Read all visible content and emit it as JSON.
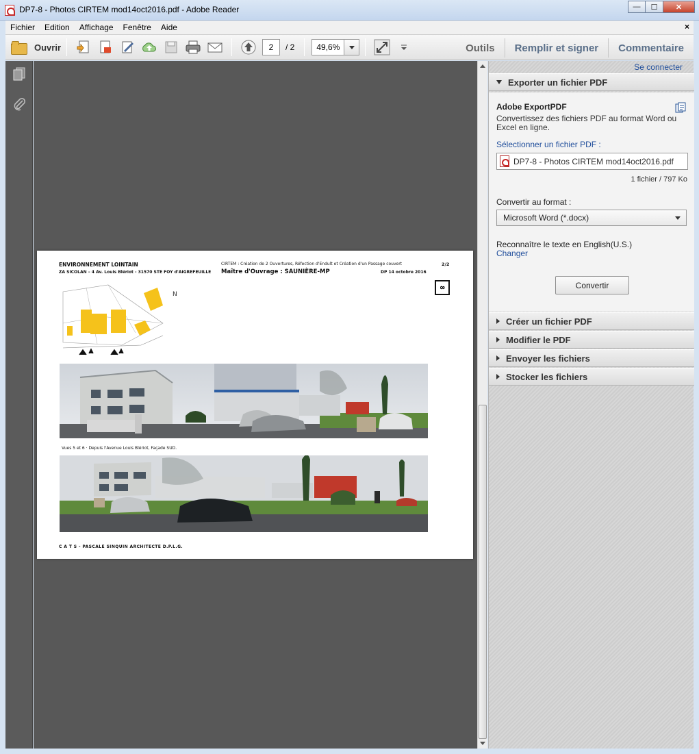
{
  "window": {
    "title": "DP7-8 - Photos CIRTEM mod14oct2016.pdf - Adobe Reader",
    "minimize": "—",
    "maximize": "☐",
    "close": "✕"
  },
  "menu": {
    "items": [
      "Fichier",
      "Edition",
      "Affichage",
      "Fenêtre",
      "Aide"
    ],
    "close_doc": "×"
  },
  "toolbar": {
    "open_label": "Ouvrir",
    "page_current": "2",
    "page_total": "/ 2",
    "zoom": "49,6%",
    "tools_label": "Outils",
    "fill_sign_label": "Remplir et signer",
    "comment_label": "Commentaire"
  },
  "pdf_page": {
    "header_left_1": "ENVIRONNEMENT  LOINTAIN",
    "header_left_2": "ZA  SICOLAN – 4 Av. Louis Blériot  - 31570 STE FOY d'AIGREFEUILLE",
    "header_mid_1": "CIRTEM :  Création de 2 Ouvertures,  Réfection d'Endult et Création d'un Passage couvert",
    "header_mid_2": "Maître d'Ouvrage : SAUNIÈRE-MP",
    "header_right_1": "2/2",
    "header_right_2": "DP 14 octobre 2016",
    "page_box": "8",
    "caption": "Vues 5 et 6  ·  Depuis l'Avenue Louis Blériot, Façade SUD.",
    "footer": "C  A  T  S   -   PASCALE SINQUIN   ARCHITECTE D.P.L.G."
  },
  "right_panel": {
    "connect": "Se connecter",
    "export_header": "Exporter un fichier PDF",
    "export_title": "Adobe ExportPDF",
    "export_desc": "Convertissez des fichiers PDF au format Word ou Excel en ligne.",
    "select_label": "Sélectionner un fichier PDF :",
    "file_name": "DP7-8 - Photos CIRTEM mod14oct2016.pdf",
    "file_count": "1 fichier / 797 Ko",
    "format_label": "Convertir au format :",
    "format_value": "Microsoft Word (*.docx)",
    "ocr_text": "Reconnaître le texte en English(U.S.)",
    "change_label": "Changer",
    "convert_button": "Convertir",
    "sections": [
      "Créer un fichier PDF",
      "Modifier le PDF",
      "Envoyer les fichiers",
      "Stocker les fichiers"
    ]
  },
  "colors": {
    "link_blue": "#1f4d9b",
    "doc_background": "#585858",
    "building_yellow": "#f5c21b"
  }
}
